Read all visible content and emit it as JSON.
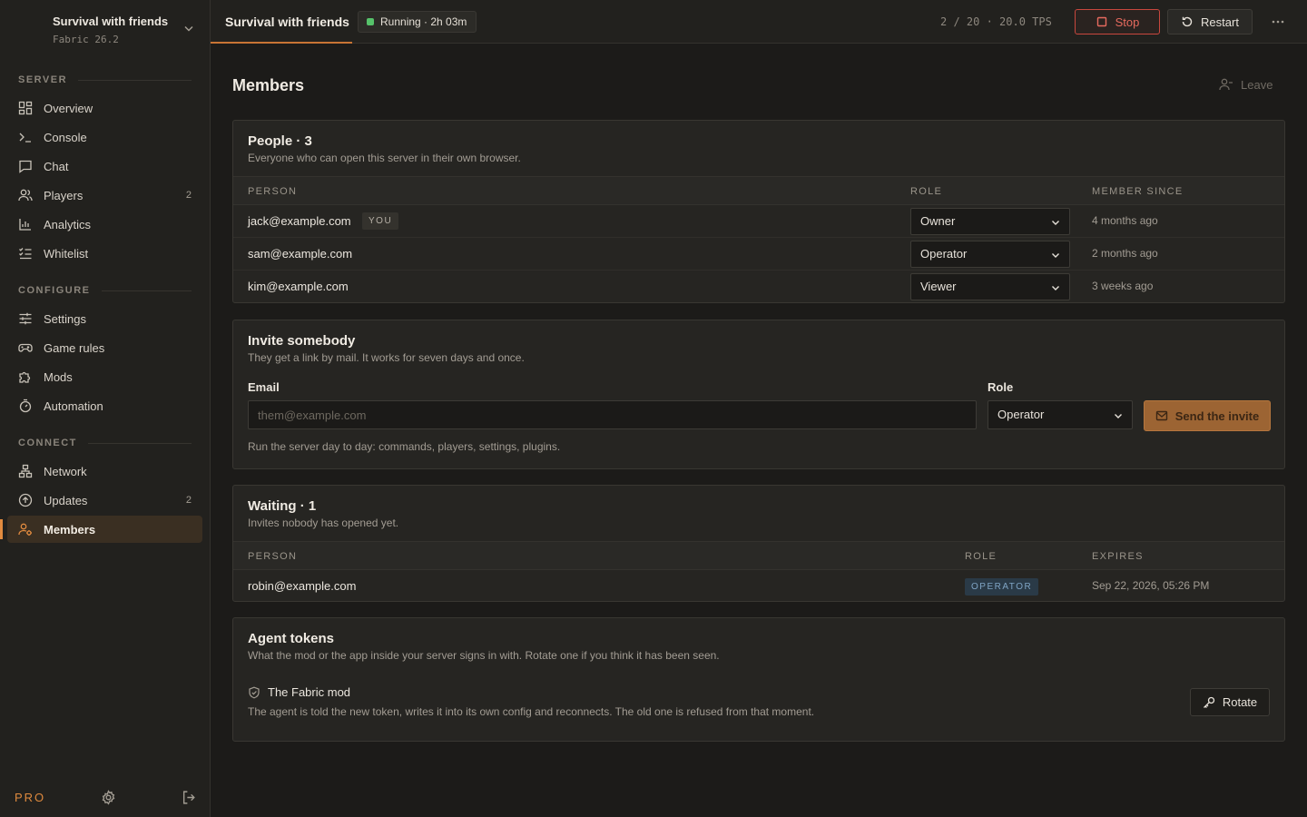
{
  "server": {
    "name": "Survival with friends",
    "version": "Fabric 26.2"
  },
  "topbar": {
    "title": "Survival with friends",
    "status": "Running · 2h 03m",
    "players_tps": "2 / 20 · 20.0 TPS",
    "stop_label": "Stop",
    "restart_label": "Restart"
  },
  "nav": {
    "server_label": "SERVER",
    "configure_label": "CONFIGURE",
    "connect_label": "CONNECT",
    "items": [
      {
        "label": "Overview",
        "icon": "grid-icon"
      },
      {
        "label": "Console",
        "icon": "terminal-icon"
      },
      {
        "label": "Chat",
        "icon": "chat-icon"
      },
      {
        "label": "Players",
        "icon": "users-icon",
        "count": "2"
      },
      {
        "label": "Analytics",
        "icon": "chart-icon"
      },
      {
        "label": "Whitelist",
        "icon": "checklist-icon"
      },
      {
        "label": "Settings",
        "icon": "sliders-icon"
      },
      {
        "label": "Game rules",
        "icon": "gamepad-icon"
      },
      {
        "label": "Mods",
        "icon": "puzzle-icon"
      },
      {
        "label": "Automation",
        "icon": "timer-icon"
      },
      {
        "label": "Network",
        "icon": "network-icon"
      },
      {
        "label": "Updates",
        "icon": "arrow-up-circle-icon",
        "count": "2"
      },
      {
        "label": "Members",
        "icon": "members-icon"
      }
    ],
    "active": "Members",
    "plan": "PRO"
  },
  "page": {
    "title": "Members",
    "leave_label": "Leave"
  },
  "people": {
    "title": "People · 3",
    "subtitle": "Everyone who can open this server in their own browser.",
    "headers": {
      "person": "PERSON",
      "role": "ROLE",
      "since": "MEMBER SINCE"
    },
    "you_badge": "YOU",
    "rows": [
      {
        "email": "jack@example.com",
        "role": "Owner",
        "since": "4 months ago"
      },
      {
        "email": "sam@example.com",
        "role": "Operator",
        "since": "2 months ago"
      },
      {
        "email": "kim@example.com",
        "role": "Viewer",
        "since": "3 weeks ago"
      }
    ]
  },
  "invite": {
    "title": "Invite somebody",
    "subtitle": "They get a link by mail. It works for seven days and once.",
    "email_label": "Email",
    "email_placeholder": "them@example.com",
    "email_value": "",
    "role_label": "Role",
    "role_value": "Operator",
    "send_label": "Send the invite",
    "role_hint": "Run the server day to day: commands, players, settings, plugins."
  },
  "waiting": {
    "title": "Waiting · 1",
    "subtitle": "Invites nobody has opened yet.",
    "headers": {
      "person": "PERSON",
      "role": "ROLE",
      "expires": "EXPIRES"
    },
    "rows": [
      {
        "email": "robin@example.com",
        "role": "OPERATOR",
        "expires": "Sep 22, 2026, 05:26 PM"
      }
    ]
  },
  "tokens": {
    "title": "Agent tokens",
    "subtitle": "What the mod or the app inside your server signs in with. Rotate one if you think it has been seen.",
    "item_name": "The Fabric mod",
    "item_desc": "The agent is told the new token, writes it into its own config and reconnects. The old one is refused from that moment.",
    "rotate_label": "Rotate"
  },
  "colors": {
    "accent": "#e28b3f",
    "running": "#56c26a",
    "danger": "#c8473e"
  }
}
